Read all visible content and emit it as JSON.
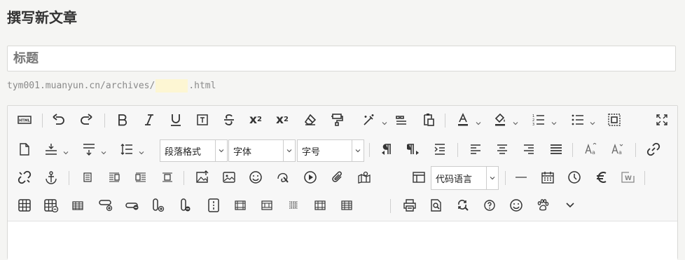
{
  "page": {
    "title": "撰写新文章"
  },
  "title_field": {
    "placeholder": "标题",
    "value": ""
  },
  "slug": {
    "prefix": "tym001.muanyun.cn/archives/",
    "suffix": ".html",
    "value": ""
  },
  "toolbar": {
    "row1": [
      {
        "name": "source-html-icon",
        "label": "HTML"
      },
      {
        "name": "undo-icon"
      },
      {
        "name": "redo-icon"
      },
      {
        "name": "bold-icon",
        "label": "B"
      },
      {
        "name": "italic-icon",
        "label": "I"
      },
      {
        "name": "underline-icon",
        "label": "U"
      },
      {
        "name": "fontborder-icon",
        "label": "T"
      },
      {
        "name": "strikethrough-icon",
        "label": "S"
      },
      {
        "name": "superscript-icon",
        "label": "x²"
      },
      {
        "name": "subscript-icon",
        "label": "x₂"
      },
      {
        "name": "remove-format-icon"
      },
      {
        "name": "format-match-icon"
      },
      {
        "name": "auto-typeset-icon"
      },
      {
        "name": "blockquote-icon"
      },
      {
        "name": "paste-plain-icon"
      },
      {
        "name": "forecolor-icon",
        "label": "A"
      },
      {
        "name": "backcolor-icon"
      },
      {
        "name": "ordered-list-icon"
      },
      {
        "name": "unordered-list-icon"
      },
      {
        "name": "select-all-icon"
      },
      {
        "name": "fullscreen-icon"
      }
    ],
    "row2": {
      "paragraph_format": "段落格式",
      "font_family": "字体",
      "font_size": "字号"
    },
    "row3": {
      "code_language": "代码语言"
    }
  },
  "colors": {
    "background": "#f5f5f3",
    "toolbar_bg": "#f7f7f7",
    "slug_highlight": "#fdf6d3",
    "border": "#d9d9d6"
  }
}
